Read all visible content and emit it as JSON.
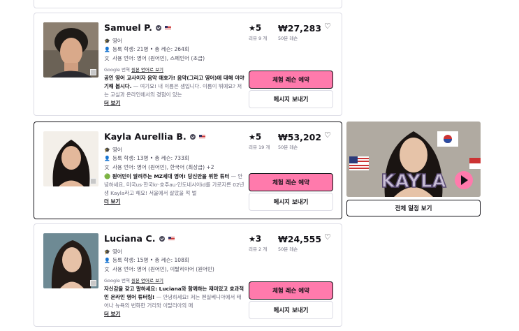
{
  "tutors": [
    {
      "name": "Samuel P.",
      "subject": "영어",
      "students": "등록 학생: 21명 • 총 레슨: 264회",
      "languages": "사용 언어: 영어 (원어민), 스페인어 (초급)",
      "translate_prefix": "Google 번역",
      "translate_link": "원본 언어로 보기",
      "headline": "공인 영어 교사이자 음악 애호가! 음악(그리고 영어)에 대해 이야기해 봅시다.",
      "description": " — 여기요! 내 이름은 샘입니다. 이름이 뭐예요? 저는 교실과 온라인에서의 경험이 있는",
      "more": "더 보기",
      "rating": "5",
      "reviews": "리뷰 9 개",
      "price": "₩27,283",
      "lesson_length": "50분 레슨",
      "trial_label": "체험 레슨 예약",
      "message_label": "메시지 보내기"
    },
    {
      "name": "Kayla Aurellia B.",
      "subject": "영어",
      "students": "등록 학생: 13명 • 총 레슨: 733회",
      "languages": "사용 언어: 영어 (원어민), 한국어 (최상급) +2",
      "headline": "🟢 원어민이 알려주는 MZ세대 영어! 당신만을 위한 튜터",
      "description": " — 안녕하세요, 미국us·한국kr·호주au·인도네시아id를 가로지른 02년생 Kayla라고 해요! 서울에서 살았을 적 벌",
      "more": "더 보기",
      "rating": "5",
      "reviews": "리뷰 19 개",
      "price": "₩53,202",
      "lesson_length": "50분 레슨",
      "trial_label": "체험 레슨 예약",
      "message_label": "메시지 보내기",
      "video_text": "KAYLA",
      "schedule_label": "전체 일정 보기"
    },
    {
      "name": "Luciana C.",
      "subject": "영어",
      "students": "등록 학생: 15명 • 총 레슨: 108회",
      "languages": "사용 언어: 영어 (원어민), 이탈리아어 (원어민)",
      "translate_prefix": "Google 번역",
      "translate_link": "원본 언어로 보기",
      "headline": "자신감을 갖고 말하세요: Luciana와 함께하는 재미있고 효과적인 온라인 영어 튜터링!",
      "description": " — 안녕하세요! 저는 펜실베니아에서 태어나 뉴욕의 번화한 거리와 이탈리아의 매",
      "more": "더 보기",
      "rating": "3",
      "reviews": "리뷰 2 개",
      "price": "₩24,555",
      "lesson_length": "50분 레슨",
      "trial_label": "체험 레슨 예약",
      "message_label": "메시지 보내기"
    }
  ],
  "colors": {
    "accent": "#ff7aac",
    "border": "#dcdce5",
    "text": "#121117"
  },
  "icons": {
    "subject": "hat-icon",
    "students": "person-icon",
    "languages": "translate-icon",
    "favorite": "heart-icon",
    "rating": "star-icon",
    "play": "play-icon"
  }
}
